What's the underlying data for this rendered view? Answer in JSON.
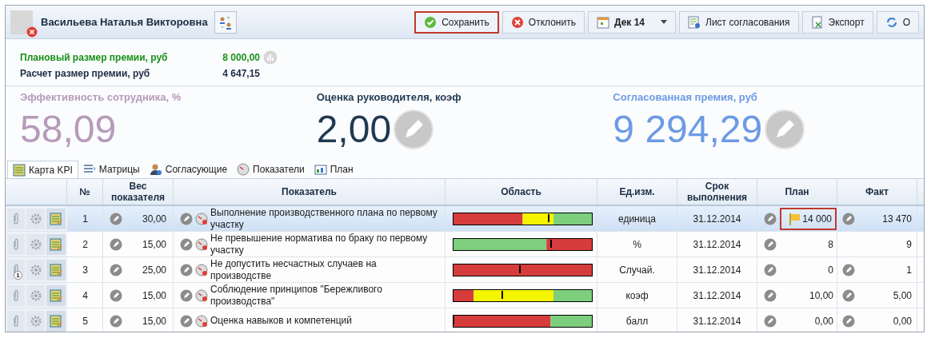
{
  "employee": {
    "name": "Васильева Наталья Викторовна",
    "blocked": true
  },
  "toolbar": [
    {
      "kind": "save",
      "label": "Сохранить",
      "highlighted": true
    },
    {
      "kind": "reject",
      "label": "Отклонить",
      "highlighted": false
    },
    {
      "kind": "period",
      "label": "Дек 14",
      "highlighted": false
    },
    {
      "kind": "sheet",
      "label": "Лист согласования",
      "highlighted": false
    },
    {
      "kind": "export",
      "label": "Экспорт",
      "highlighted": false
    },
    {
      "kind": "refresh",
      "label": "О",
      "highlighted": false
    }
  ],
  "bonus": [
    {
      "label": "Плановый размер премии, руб",
      "value": "8 000,00",
      "color": "#179117",
      "chart": true
    },
    {
      "label": "Расчет размер премии, руб",
      "value": "4 647,15",
      "color": "#1c2c44",
      "chart": false
    }
  ],
  "metrics": [
    {
      "label": "Эффективность сотрудника, %",
      "value": "58,09",
      "color": "#b69bb9",
      "editable": false
    },
    {
      "label": "Оценка руководителя, коэф",
      "value": "2,00",
      "color": "#1f3a52",
      "editable": true
    },
    {
      "label": "Согласованная премия, руб",
      "value": "9 294,29",
      "color": "#6d9be3",
      "editable": true
    }
  ],
  "tabs": [
    {
      "kind": "kpi",
      "label": "Карта KPI",
      "selected": true
    },
    {
      "kind": "matrix",
      "label": "Матрицы",
      "selected": false
    },
    {
      "kind": "approvers",
      "label": "Согласующие",
      "selected": false
    },
    {
      "kind": "gauge",
      "label": "Показатели",
      "selected": false
    },
    {
      "kind": "plan",
      "label": "План",
      "selected": false
    }
  ],
  "table": {
    "columns": [
      "№",
      "Вес показателя",
      "Показатель",
      "Область",
      "Ед.изм.",
      "Срок выполнения",
      "План",
      "Факт"
    ],
    "rows": [
      {
        "selected": true,
        "attachments": "",
        "num": "1",
        "weight": "30,00",
        "name": "Выполнение производственного плана по первому участку",
        "region": {
          "level": 0.7
        },
        "unit": "единица",
        "due": "31.12.2014",
        "plan": {
          "value": "14 000",
          "editable": true,
          "flagged": true
        },
        "fact": {
          "value": "13 470",
          "editable": true
        }
      },
      {
        "selected": false,
        "attachments": "",
        "num": "2",
        "weight": "15,00",
        "name": "Не превышение норматива по браку по первому участку",
        "region": {
          "level": 0.72
        },
        "unit": "%",
        "due": "31.12.2014",
        "plan": {
          "value": "8",
          "editable": true,
          "flagged": false
        },
        "fact": {
          "value": "9",
          "editable": false
        }
      },
      {
        "selected": false,
        "attachments": "1",
        "num": "3",
        "weight": "25,00",
        "name": "Не допустить несчастных случаев на производстве",
        "region": {
          "level": 0.49
        },
        "unit": "Случай.",
        "due": "31.12.2014",
        "plan": {
          "value": "0",
          "editable": true,
          "flagged": false
        },
        "fact": {
          "value": "1",
          "editable": true
        }
      },
      {
        "selected": false,
        "attachments": "",
        "num": "4",
        "weight": "15,00",
        "name": "Соблюдение принципов \"Бережливого производства\"",
        "region": {
          "level": 0.36
        },
        "unit": "коэф",
        "due": "31.12.2014",
        "plan": {
          "value": "10,00",
          "editable": true,
          "flagged": false
        },
        "fact": {
          "value": "5,00",
          "editable": true
        }
      },
      {
        "selected": false,
        "attachments": "",
        "num": "5",
        "weight": "15,00",
        "name": "Оценка навыков и компетенций",
        "region": {
          "level": 0.005
        },
        "unit": "балл",
        "due": "31.12.2014",
        "plan": {
          "value": "0,00",
          "editable": true,
          "flagged": false
        },
        "fact": {
          "value": "0,00",
          "editable": true
        }
      }
    ]
  }
}
